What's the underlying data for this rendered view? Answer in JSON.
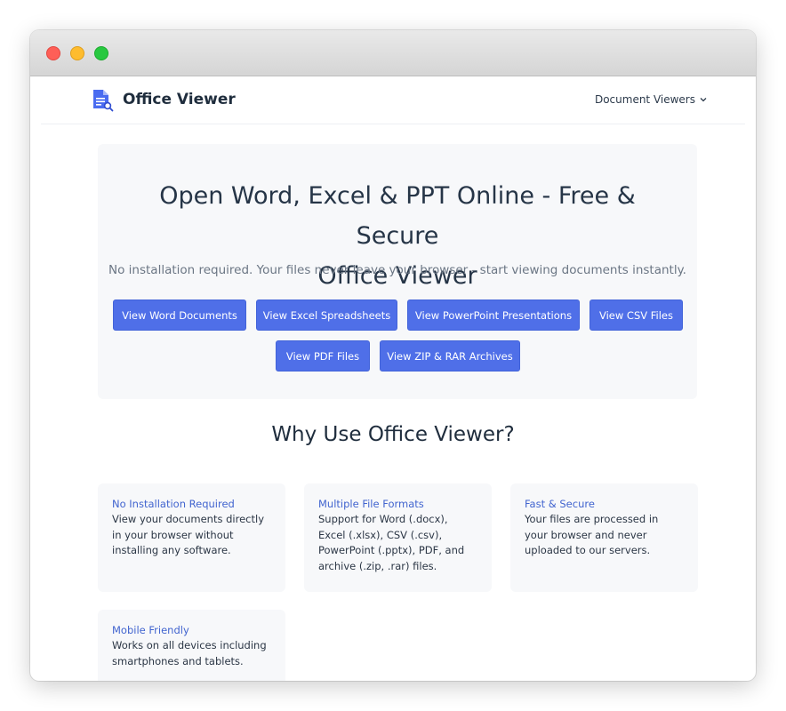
{
  "nav": {
    "brand": "Office Viewer",
    "menu_label": "Document Viewers"
  },
  "hero": {
    "title_line1": "Open Word, Excel & PPT Online - Free & Secure",
    "title_line2": "Office Viewer",
    "subtitle": "No installation required. Your files never leave your browser - start viewing documents instantly.",
    "buttons": [
      "View Word Documents",
      "View Excel Spreadsheets",
      "View PowerPoint Presentations",
      "View CSV Files",
      "View PDF Files",
      "View ZIP & RAR Archives"
    ]
  },
  "features": {
    "title": "Why Use Office Viewer?",
    "cards": [
      {
        "title": "No Installation Required",
        "text": "View your documents directly in your browser without installing any software."
      },
      {
        "title": "Multiple File Formats",
        "text": "Support for Word (.docx), Excel (.xlsx), CSV (.csv), PowerPoint (.pptx), PDF, and archive (.zip, .rar) files."
      },
      {
        "title": "Fast & Secure",
        "text": "Your files are processed in your browser and never uploaded to our servers."
      },
      {
        "title": "Mobile Friendly",
        "text": "Works on all devices including smartphones and tablets."
      }
    ]
  },
  "colors": {
    "accent": "#4f6fe8",
    "heading": "#263547",
    "card_bg": "#f7f8fa",
    "card_title": "#4164cf"
  },
  "icons": {
    "logo": "document-search-icon",
    "menu_caret": "chevron-down-icon"
  }
}
